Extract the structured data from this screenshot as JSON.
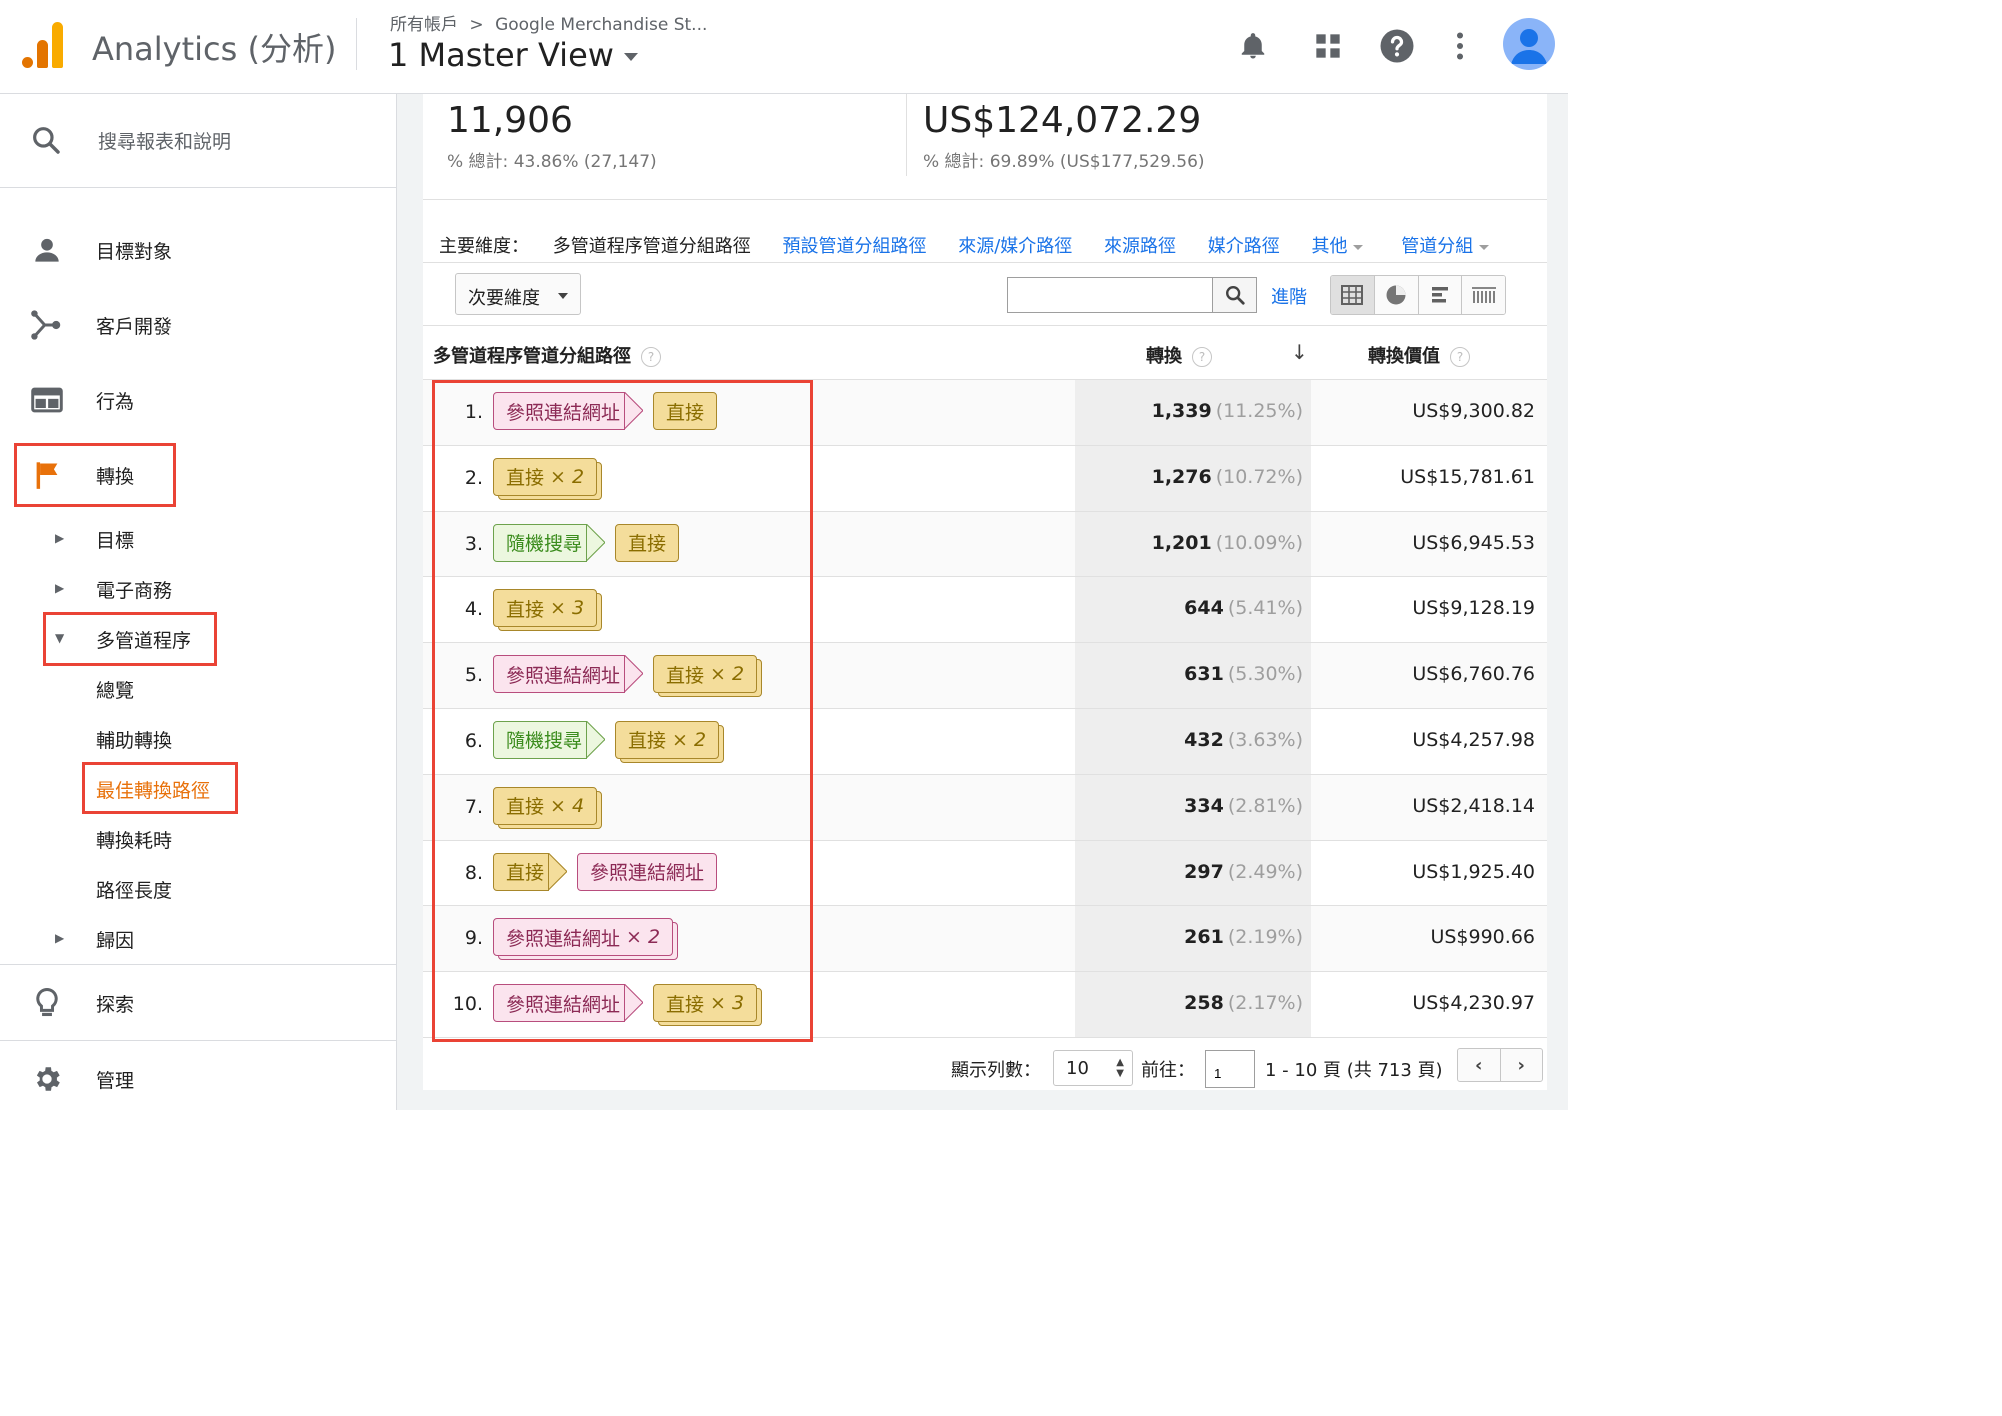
{
  "header": {
    "app_title": "Analytics (分析)",
    "breadcrumb_root": "所有帳戶",
    "breadcrumb_sep": ">",
    "breadcrumb_property": "Google Merchandise St...",
    "view_name": "1 Master View"
  },
  "sidebar": {
    "search_placeholder": "搜尋報表和說明",
    "items": [
      {
        "label": "目標對象",
        "icon": "person-icon"
      },
      {
        "label": "客戶開發",
        "icon": "acquisition-icon"
      },
      {
        "label": "行為",
        "icon": "behavior-icon"
      },
      {
        "label": "轉換",
        "icon": "flag-icon",
        "active": true
      }
    ],
    "sub_items": [
      {
        "label": "目標",
        "expandable": true
      },
      {
        "label": "電子商務",
        "expandable": true
      },
      {
        "label": "多管道程序",
        "expanded": true
      },
      {
        "label": "總覽"
      },
      {
        "label": "輔助轉換"
      },
      {
        "label": "最佳轉換路徑",
        "active": true
      },
      {
        "label": "轉換耗時"
      },
      {
        "label": "路徑長度"
      },
      {
        "label": "歸因",
        "expandable": true
      }
    ],
    "discover_label": "探索",
    "admin_label": "管理"
  },
  "summary": {
    "conversions_value": "11,906",
    "conversions_total": "% 總計: 43.86% (27,147)",
    "value_value": "US$124,072.29",
    "value_total": "% 總計: 69.89% (US$177,529.56)"
  },
  "dimensions": {
    "lead": "主要維度：",
    "current": "多管道程序管道分組路徑",
    "links": [
      "預設管道分組路徑",
      "來源/媒介路徑",
      "來源路徑",
      "媒介路徑"
    ],
    "more": "其他",
    "channel_group": "管道分組"
  },
  "toolbar": {
    "secondary_dimension": "次要維度",
    "search_value": "",
    "advanced": "進階"
  },
  "table": {
    "col_path": "多管道程序管道分組路徑",
    "col_conversions": "轉換",
    "col_value": "轉換價值",
    "sort_arrow": "↓",
    "rows": [
      {
        "rank": "1.",
        "path": [
          {
            "label": "參照連結網址",
            "type": "ref"
          },
          {
            "label": "直接",
            "type": "dir"
          }
        ],
        "conversions": "1,339",
        "pct": "(11.25%)",
        "value": "US$9,300.82"
      },
      {
        "rank": "2.",
        "path": [
          {
            "label": "直接",
            "type": "dir",
            "count": "× 2"
          }
        ],
        "conversions": "1,276",
        "pct": "(10.72%)",
        "value": "US$15,781.61"
      },
      {
        "rank": "3.",
        "path": [
          {
            "label": "隨機搜尋",
            "type": "org"
          },
          {
            "label": "直接",
            "type": "dir"
          }
        ],
        "conversions": "1,201",
        "pct": "(10.09%)",
        "value": "US$6,945.53"
      },
      {
        "rank": "4.",
        "path": [
          {
            "label": "直接",
            "type": "dir",
            "count": "× 3"
          }
        ],
        "conversions": "644",
        "pct": "(5.41%)",
        "value": "US$9,128.19"
      },
      {
        "rank": "5.",
        "path": [
          {
            "label": "參照連結網址",
            "type": "ref"
          },
          {
            "label": "直接",
            "type": "dir",
            "count": "× 2"
          }
        ],
        "conversions": "631",
        "pct": "(5.30%)",
        "value": "US$6,760.76"
      },
      {
        "rank": "6.",
        "path": [
          {
            "label": "隨機搜尋",
            "type": "org"
          },
          {
            "label": "直接",
            "type": "dir",
            "count": "× 2"
          }
        ],
        "conversions": "432",
        "pct": "(3.63%)",
        "value": "US$4,257.98"
      },
      {
        "rank": "7.",
        "path": [
          {
            "label": "直接",
            "type": "dir",
            "count": "× 4"
          }
        ],
        "conversions": "334",
        "pct": "(2.81%)",
        "value": "US$2,418.14"
      },
      {
        "rank": "8.",
        "path": [
          {
            "label": "直接",
            "type": "dir"
          },
          {
            "label": "參照連結網址",
            "type": "ref"
          }
        ],
        "conversions": "297",
        "pct": "(2.49%)",
        "value": "US$1,925.40"
      },
      {
        "rank": "9.",
        "path": [
          {
            "label": "參照連結網址",
            "type": "ref",
            "count": "× 2"
          }
        ],
        "conversions": "261",
        "pct": "(2.19%)",
        "value": "US$990.66"
      },
      {
        "rank": "10.",
        "path": [
          {
            "label": "參照連結網址",
            "type": "ref"
          },
          {
            "label": "直接",
            "type": "dir",
            "count": "× 3"
          }
        ],
        "conversions": "258",
        "pct": "(2.17%)",
        "value": "US$4,230.97"
      }
    ]
  },
  "pager": {
    "rows_label": "顯示列數：",
    "rows_value": "10",
    "goto_label": "前往：",
    "goto_value": "1",
    "range": "1 - 10 頁 (共 713 頁)"
  },
  "colors": {
    "accent_orange": "#e8710a",
    "highlight_red": "#ea4335",
    "link_blue": "#1a73e8",
    "referral_chip": "#fbe4ee",
    "direct_chip": "#f4dd9b",
    "organic_chip": "#ecf7df"
  }
}
